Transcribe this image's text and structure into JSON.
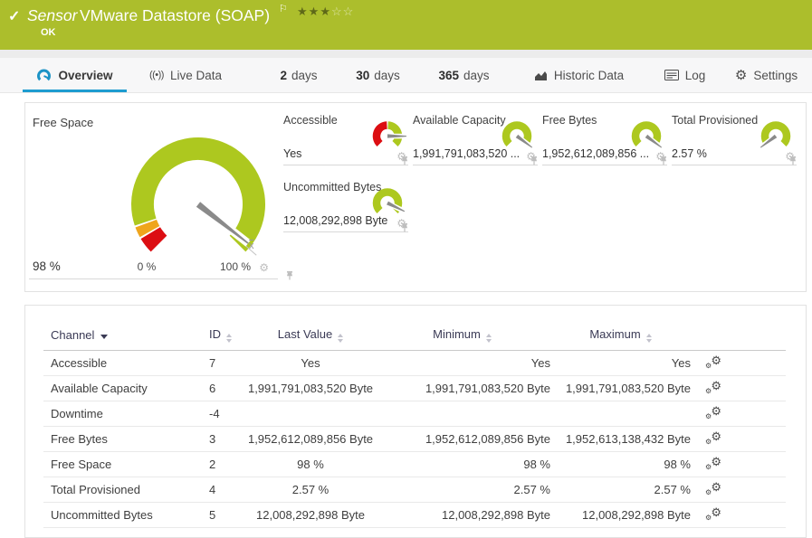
{
  "header": {
    "kind": "Sensor",
    "title": "VMware Datastore (SOAP)",
    "status": "OK",
    "stars_filled": 3,
    "stars_total": 5,
    "bg_color": "#ACBE2C"
  },
  "tabs": [
    {
      "id": "overview",
      "label": "Overview",
      "icon": "gauge-icon",
      "active": true
    },
    {
      "id": "live-data",
      "label": "Live Data",
      "icon": "live-icon"
    },
    {
      "id": "days-2",
      "num": "2",
      "label": "days"
    },
    {
      "id": "days-30",
      "num": "30",
      "label": "days"
    },
    {
      "id": "days-365",
      "num": "365",
      "label": "days"
    },
    {
      "id": "historic-data",
      "label": "Historic Data",
      "icon": "historic-icon"
    },
    {
      "id": "log",
      "label": "Log",
      "icon": "log-icon"
    },
    {
      "id": "settings",
      "label": "Settings",
      "icon": "settings-icon"
    }
  ],
  "free_space": {
    "label": "Free Space",
    "value": "98 %",
    "min_label": "0 %",
    "max_label": "100 %",
    "mean_marker": "x",
    "gauge": {
      "needle": 0.974,
      "segments": [
        {
          "from": 0,
          "to": 0.052,
          "color": "#DC0E12"
        },
        {
          "from": 0.058,
          "to": 0.092,
          "color": "#EFA51D"
        },
        {
          "from": 0.098,
          "to": 1,
          "color": "#ADC81F"
        }
      ]
    }
  },
  "tiles": [
    {
      "id": "accessible",
      "label": "Accessible",
      "value": "Yes",
      "gauge": {
        "needle": 0.835,
        "segments": [
          {
            "from": 0,
            "to": 0.49,
            "color": "#DC0E12"
          },
          {
            "from": 0.51,
            "to": 1,
            "color": "#ADC81F"
          }
        ]
      }
    },
    {
      "id": "available-capacity",
      "label": "Available Capacity",
      "value": "1,991,791,083,520 ...",
      "gauge": {
        "needle": 0.97,
        "segments": [
          {
            "from": 0,
            "to": 1,
            "color": "#ADC81F"
          }
        ]
      }
    },
    {
      "id": "free-bytes",
      "label": "Free Bytes",
      "value": "1,952,612,089,856 ...",
      "gauge": {
        "needle": 0.97,
        "segments": [
          {
            "from": 0,
            "to": 1,
            "color": "#ADC81F"
          }
        ]
      }
    },
    {
      "id": "total-provisioned",
      "label": "Total Provisioned",
      "value": "2.57 %",
      "gauge": {
        "needle": 0.03,
        "segments": [
          {
            "from": 0,
            "to": 1,
            "color": "#ADC81F"
          }
        ]
      }
    },
    {
      "id": "uncommitted-bytes",
      "label": "Uncommitted Bytes",
      "value": "12,008,292,898 Byte",
      "gauge": {
        "needle": 0.93,
        "segments": [
          {
            "from": 0,
            "to": 1,
            "color": "#ADC81F"
          }
        ]
      }
    }
  ],
  "table": {
    "columns": [
      {
        "label": "Channel",
        "sort": "active-desc"
      },
      {
        "label": "ID",
        "sort": "both"
      },
      {
        "label": "Last Value",
        "sort": "both"
      },
      {
        "label": "Minimum",
        "sort": "both"
      },
      {
        "label": "Maximum",
        "sort": "both"
      }
    ],
    "rows": [
      {
        "channel": "Accessible",
        "id": "7",
        "last": "Yes",
        "min": "Yes",
        "max": "Yes"
      },
      {
        "channel": "Available Capacity",
        "id": "6",
        "last": "1,991,791,083,520 Byte",
        "min": "1,991,791,083,520 Byte",
        "max": "1,991,791,083,520 Byte"
      },
      {
        "channel": "Downtime",
        "id": "-4",
        "last": "",
        "min": "",
        "max": ""
      },
      {
        "channel": "Free Bytes",
        "id": "3",
        "last": "1,952,612,089,856 Byte",
        "min": "1,952,612,089,856 Byte",
        "max": "1,952,613,138,432 Byte"
      },
      {
        "channel": "Free Space",
        "id": "2",
        "last": "98 %",
        "min": "98 %",
        "max": "98 %"
      },
      {
        "channel": "Total Provisioned",
        "id": "4",
        "last": "2.57 %",
        "min": "2.57 %",
        "max": "2.57 %"
      },
      {
        "channel": "Uncommitted Bytes",
        "id": "5",
        "last": "12,008,292,898 Byte",
        "min": "12,008,292,898 Byte",
        "max": "12,008,292,898 Byte"
      }
    ]
  },
  "colors": {
    "accent_blue": "#1E9CD0",
    "ok_green": "#ACBE2C",
    "gauge_green": "#ADC81F",
    "gauge_red": "#DC0E12",
    "gauge_orange": "#EFA51D",
    "needle_gray": "#8A8A8A"
  }
}
